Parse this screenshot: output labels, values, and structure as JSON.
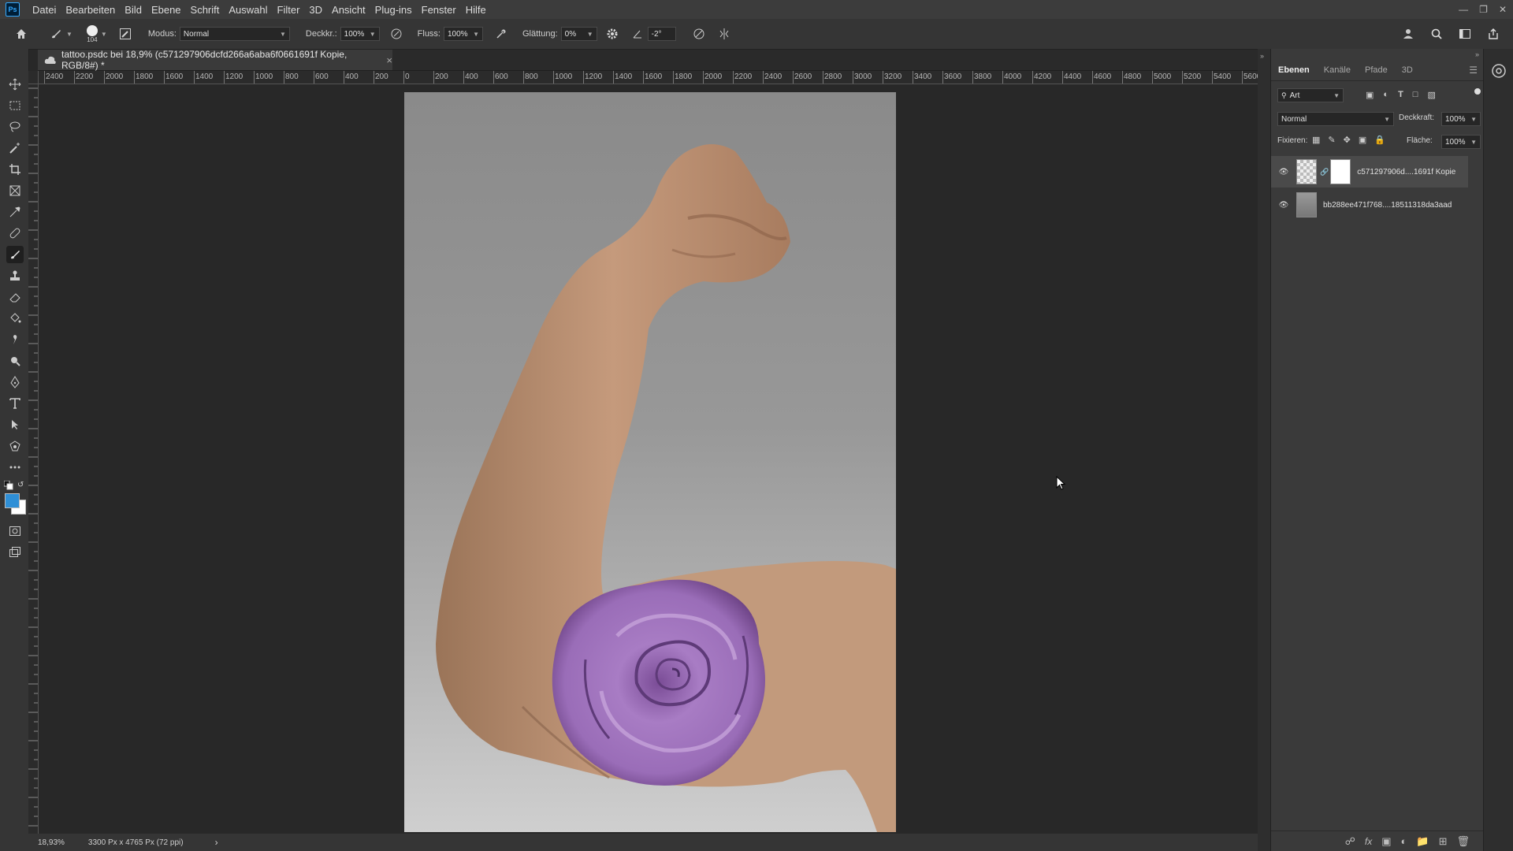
{
  "app": {
    "logo": "Ps"
  },
  "menu": [
    "Datei",
    "Bearbeiten",
    "Bild",
    "Ebene",
    "Schrift",
    "Auswahl",
    "Filter",
    "3D",
    "Ansicht",
    "Plug-ins",
    "Fenster",
    "Hilfe"
  ],
  "options": {
    "brush_size": "104",
    "mode_label": "Modus:",
    "mode_value": "Normal",
    "opacity_label": "Deckkr.:",
    "opacity_value": "100%",
    "flow_label": "Fluss:",
    "flow_value": "100%",
    "smoothing_label": "Glättung:",
    "smoothing_value": "0%",
    "angle_value": "-2°"
  },
  "document": {
    "tab_title": "tattoo.psdc bei 18,9% (c571297906dcfd266a6aba6f0661691f Kopie, RGB/8#) *",
    "close": "×"
  },
  "hruler_ticks": [
    "2400",
    "2200",
    "2000",
    "1800",
    "1600",
    "1400",
    "1200",
    "1000",
    "800",
    "600",
    "400",
    "200",
    "0",
    "200",
    "400",
    "600",
    "800",
    "1000",
    "1200",
    "1400",
    "1600",
    "1800",
    "2000",
    "2200",
    "2400",
    "2600",
    "2800",
    "3000",
    "3200",
    "3400",
    "3600",
    "3800",
    "4000",
    "4200",
    "4400",
    "4600",
    "4800",
    "5000",
    "5200",
    "5400",
    "5600"
  ],
  "status": {
    "zoom": "18,93%",
    "doc_size": "3300 Px x 4765 Px (72 ppi)",
    "arrow": "›"
  },
  "panel": {
    "tabs": [
      "Ebenen",
      "Kanäle",
      "Pfade",
      "3D"
    ],
    "filter_kind": "Art",
    "blend_mode": "Normal",
    "opacity_label": "Deckkraft:",
    "opacity_value": "100%",
    "lock_label": "Fixieren:",
    "fill_label": "Fläche:",
    "fill_value": "100%",
    "layers": [
      {
        "name": "c571297906d....1691f Kopie",
        "selected": true
      },
      {
        "name": "bb288ee471f768....18511318da3aad",
        "selected": false
      }
    ]
  },
  "colors": {
    "foreground": "#2f8fd6",
    "background": "#ffffff",
    "accent": "#31a8ff"
  },
  "icons": [
    "home-icon",
    "brush-icon",
    "move-icon",
    "marquee-icon",
    "lasso-icon",
    "magic-wand-icon",
    "crop-icon",
    "frame-icon",
    "eyedropper-icon",
    "healing-icon",
    "brush-tool-icon",
    "stamp-icon",
    "eraser-icon",
    "bucket-icon",
    "smudge-icon",
    "dodge-icon",
    "pen-icon",
    "type-icon",
    "path-select-icon",
    "shape-icon",
    "more-icon",
    "eye-icon",
    "search-icon",
    "share-icon",
    "lock-icon",
    "trash-icon"
  ]
}
